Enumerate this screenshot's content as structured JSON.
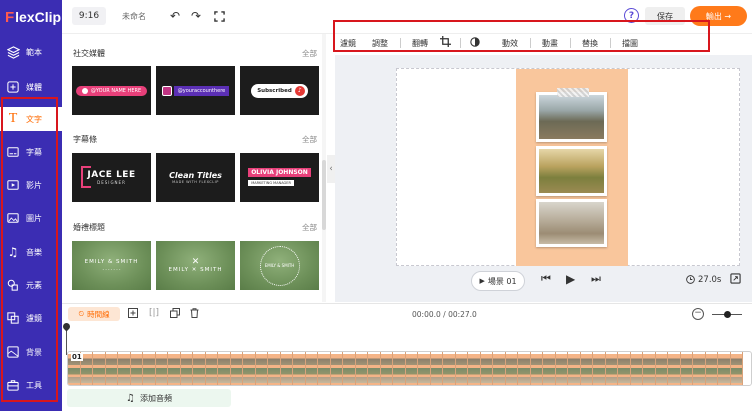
{
  "app": {
    "logo_initial": "F",
    "logo_rest": "lexClip"
  },
  "nav": {
    "items": [
      {
        "label": "範本",
        "icon": "layers-icon"
      },
      {
        "label": "媒體",
        "icon": "media-add-icon"
      },
      {
        "label": "文字",
        "icon": "text-icon"
      },
      {
        "label": "字幕",
        "icon": "subtitle-icon"
      },
      {
        "label": "影片",
        "icon": "video-icon"
      },
      {
        "label": "圖片",
        "icon": "image-icon"
      },
      {
        "label": "音樂",
        "icon": "music-icon"
      },
      {
        "label": "元素",
        "icon": "elements-icon"
      },
      {
        "label": "濾鏡",
        "icon": "overlay-icon"
      },
      {
        "label": "背景",
        "icon": "background-icon"
      },
      {
        "label": "工具",
        "icon": "toolbox-icon"
      }
    ],
    "active_index": 2
  },
  "header": {
    "ratio": "9:16",
    "project_name": "未命名",
    "save_label": "保存",
    "export_label": "輸出 →"
  },
  "panel": {
    "sections": [
      {
        "title": "社交媒體",
        "see_all": "全部",
        "thumbs": [
          {
            "text": "@YOUR NAME HERE"
          },
          {
            "text": "@youraccounthere"
          },
          {
            "text": "Subscribed"
          }
        ]
      },
      {
        "title": "字幕條",
        "see_all": "全部",
        "thumbs": [
          {
            "text": "JACE LEE",
            "sub": "DESIGNER"
          },
          {
            "text": "Clean Titles",
            "sub": "MADE WITH FLEXCLIP"
          },
          {
            "text": "OLIVIA JOHNSON",
            "sub": "MARKETING MANAGER"
          }
        ]
      },
      {
        "title": "婚禮標題",
        "see_all": "全部",
        "thumbs": [
          {
            "text": "EMILY & SMITH"
          },
          {
            "text": "EMILY",
            "sub": "SMITH"
          },
          {
            "text": "EMILY & SMITH"
          }
        ]
      }
    ]
  },
  "edit_toolbar": {
    "items": [
      "濾鏡",
      "調整",
      "翻轉",
      "",
      "",
      "動效",
      "動畫",
      "替換",
      "擋圖"
    ]
  },
  "canvas": {
    "scene_label": "場景 01",
    "duration": "27.0s"
  },
  "timeline": {
    "timeline_label": "時間線",
    "time_readout": "00:00.0 / 00:27.0",
    "scene_number": "01",
    "add_audio_label": "添加音頻",
    "zoom_level": 0.5
  },
  "colors": {
    "nav_bg": "#3b2db3",
    "accent": "#ff7a1a",
    "highlight_box": "#d8161d",
    "canvas_frame": "#f9c69c"
  }
}
